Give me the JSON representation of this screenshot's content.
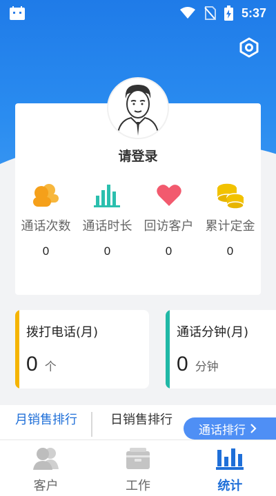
{
  "status_bar": {
    "time": "5:37"
  },
  "profile": {
    "login_text": "请登录"
  },
  "stats": [
    {
      "label": "通话次数",
      "value": "0",
      "icon": "people-group-icon",
      "color": "#f5a623"
    },
    {
      "label": "通话时长",
      "value": "0",
      "icon": "bar-chart-icon",
      "color": "#2bbfae"
    },
    {
      "label": "回访客户",
      "value": "0",
      "icon": "heart-icon",
      "color": "#f25a6e"
    },
    {
      "label": "累计定金",
      "value": "0",
      "icon": "coins-icon",
      "color": "#f2c200"
    }
  ],
  "cards": [
    {
      "title": "拨打电话(月)",
      "value": "0",
      "unit": "个",
      "accent": "#f5b400"
    },
    {
      "title": "通话分钟(月)",
      "value": "0",
      "unit": "分钟",
      "accent": "#20b8a6"
    }
  ],
  "ranking": {
    "tab_month": "月销售排行",
    "tab_day": "日销售排行",
    "button": "通话排行",
    "active_color": "#1f6fd8"
  },
  "nav": [
    {
      "label": "客户",
      "icon": "customers-icon"
    },
    {
      "label": "工作",
      "icon": "briefcase-icon"
    },
    {
      "label": "统计",
      "icon": "stats-icon",
      "active": true
    }
  ],
  "colors": {
    "brand": "#2a8cf0",
    "background": "#f2f3f5"
  }
}
